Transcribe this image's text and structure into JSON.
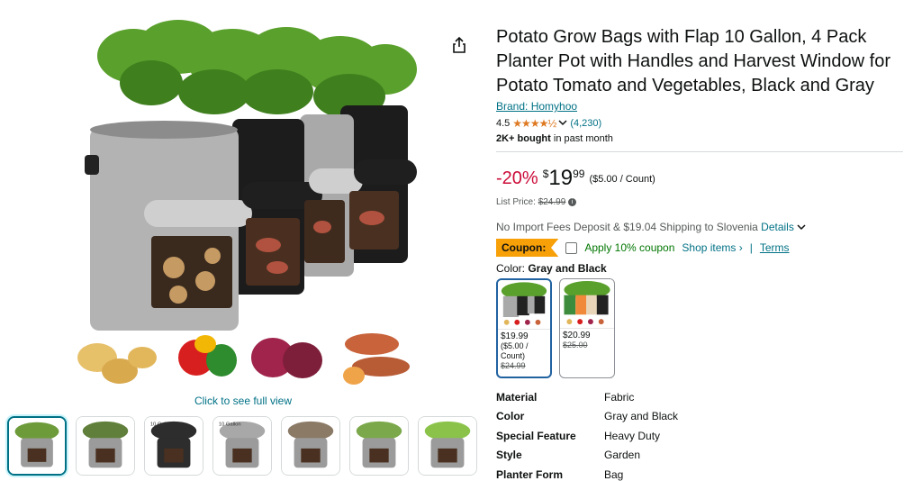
{
  "product": {
    "title": "Potato Grow Bags with Flap 10 Gallon, 4 Pack Planter Pot with Handles and Harvest Window for Potato Tomato and Vegetables, Black and Gray",
    "brand": "Brand: Homyhoo",
    "rating": "4.5",
    "stars": "★★★★½",
    "rating_count": "(4,230)",
    "bought_bold": "2K+ bought",
    "bought_rest": " in past month"
  },
  "media": {
    "full_view_label": "Click to see full view",
    "thumbnails": [
      {
        "label": "",
        "color": "#6d9b3a"
      },
      {
        "label": "",
        "color": "#5f7f3a"
      },
      {
        "label": "10 Gal",
        "color": "#2d2d2d"
      },
      {
        "label": "10 Gallon",
        "color": "#a8a8a8"
      },
      {
        "label": "",
        "color": "#8a7a66"
      },
      {
        "label": "",
        "color": "#7aa84a"
      },
      {
        "label": "",
        "color": "#8bc34a"
      }
    ]
  },
  "price": {
    "discount": "-20%",
    "symbol": "$",
    "whole": "19",
    "fraction": "99",
    "per_unit": "($5.00 / Count)",
    "list_label": "List Price: ",
    "list_value": "$24.99"
  },
  "shipping": {
    "text": "No Import Fees Deposit & $19.04 Shipping to Slovenia ",
    "details": "Details"
  },
  "coupon": {
    "badge": "Coupon:",
    "apply": "Apply 10% coupon",
    "shop": "Shop items ›",
    "sep": "|",
    "terms": "Terms"
  },
  "color": {
    "label": "Color: ",
    "selected": "Gray and Black",
    "options": [
      {
        "price": "$19.99",
        "unit": "($5.00 / Count)",
        "old": "$24.99"
      },
      {
        "price": "$20.99",
        "unit": "",
        "old": "$25.00"
      }
    ]
  },
  "specs": [
    {
      "k": "Material",
      "v": "Fabric"
    },
    {
      "k": "Color",
      "v": "Gray and Black"
    },
    {
      "k": "Special Feature",
      "v": "Heavy Duty"
    },
    {
      "k": "Style",
      "v": "Garden"
    },
    {
      "k": "Planter Form",
      "v": "Bag"
    }
  ],
  "colors": {
    "link": "#007185",
    "discount": "#cc0c39",
    "coupon": "#f7a008",
    "star": "#de7921",
    "selected_border": "#2162a1"
  }
}
